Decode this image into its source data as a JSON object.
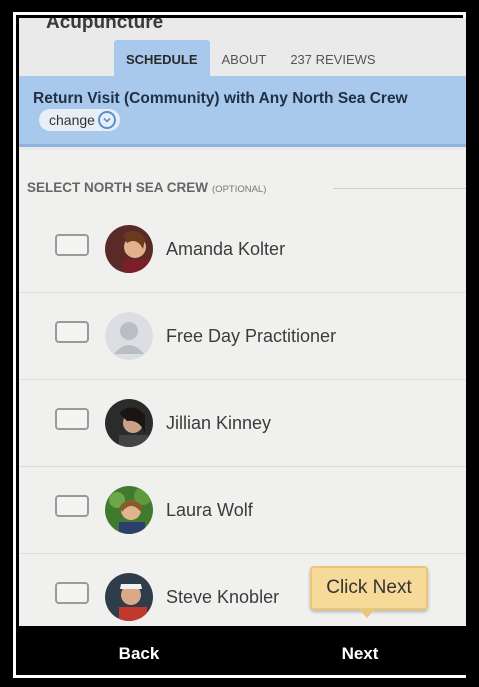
{
  "app": {
    "title": "Acupuncture"
  },
  "tabs": [
    {
      "label": "SCHEDULE",
      "active": true
    },
    {
      "label": "ABOUT",
      "active": false
    },
    {
      "label": "237 REVIEWS",
      "active": false
    }
  ],
  "visit": {
    "description": "Return Visit (Community) with Any North Sea Crew",
    "change_label": "change"
  },
  "section": {
    "label": "SELECT NORTH SEA CREW",
    "qualifier": "(OPTIONAL)"
  },
  "people": [
    {
      "name": "Amanda Kolter",
      "checked": false,
      "avatar": "photo"
    },
    {
      "name": "Free Day Practitioner",
      "checked": false,
      "avatar": "placeholder-person-icon"
    },
    {
      "name": "Jillian Kinney",
      "checked": false,
      "avatar": "photo"
    },
    {
      "name": "Laura Wolf",
      "checked": false,
      "avatar": "photo"
    },
    {
      "name": "Steve Knobler",
      "checked": false,
      "avatar": "photo"
    }
  ],
  "tooltip": {
    "text": "Click Next"
  },
  "footer": {
    "back_label": "Back",
    "next_label": "Next"
  },
  "colors": {
    "accent_blue": "#a8c8ec",
    "tooltip_bg": "#f7d99a",
    "footer_bg": "#000000"
  }
}
